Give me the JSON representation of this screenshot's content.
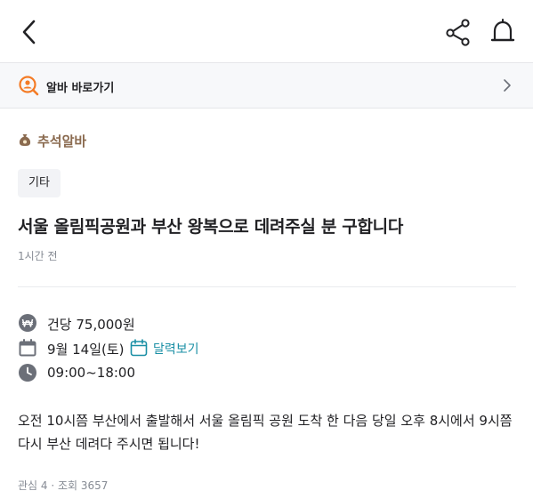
{
  "header": {
    "back_icon": "chevron-left-icon",
    "share_icon": "share-icon",
    "notify_icon": "bell-icon"
  },
  "alba_link": {
    "label": "알바 바로가기",
    "icon": "person-search-icon",
    "accent": "#f47b25"
  },
  "post": {
    "category": "추석알바",
    "category_icon": "money-bag-icon",
    "tag": "기타",
    "title": "서울 올림픽공원과 부산 왕복으로 데려주실 분 구합니다",
    "posted": "1시간 전",
    "pay": "건당 75,000원",
    "date": "9월 14일(토)",
    "calendar_link": "달력보기",
    "time": "09:00~18:00",
    "description": "오전 10시쯤 부산에서 출발해서 서울 올림픽 공원 도착 한 다음 당일 오후 8시에서 9시쯤 다시 부산 데려다 주시면 됩니다!",
    "stats": "관심 4 · 조회 3657"
  },
  "colors": {
    "link": "#1a8fa5",
    "category": "#8a6a4f",
    "muted": "#868b94"
  }
}
